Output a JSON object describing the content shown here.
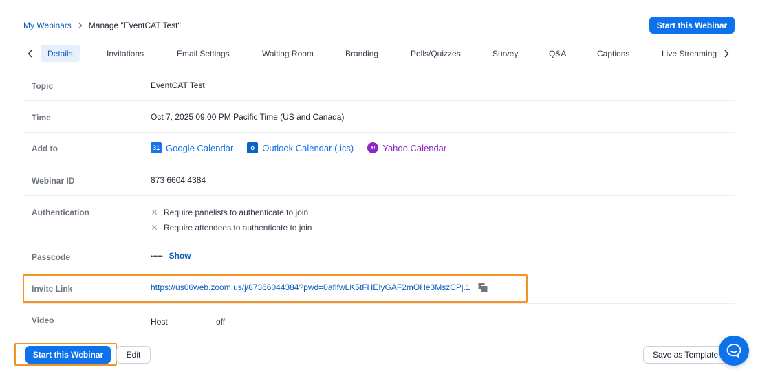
{
  "breadcrumb": {
    "root": "My Webinars",
    "current": "Manage \"EventCAT Test\""
  },
  "header": {
    "start_button": "Start this Webinar"
  },
  "tabs": [
    {
      "label": "Details",
      "active": true
    },
    {
      "label": "Invitations"
    },
    {
      "label": "Email Settings"
    },
    {
      "label": "Waiting Room"
    },
    {
      "label": "Branding"
    },
    {
      "label": "Polls/Quizzes"
    },
    {
      "label": "Survey"
    },
    {
      "label": "Q&A"
    },
    {
      "label": "Captions"
    },
    {
      "label": "Live Streaming"
    }
  ],
  "details": {
    "topic": {
      "label": "Topic",
      "value": "EventCAT Test"
    },
    "time": {
      "label": "Time",
      "value": "Oct 7, 2025 09:00 PM Pacific Time (US and Canada)"
    },
    "add_to": {
      "label": "Add to",
      "google": "Google Calendar",
      "google_icon_text": "31",
      "outlook": "Outlook Calendar (.ics)",
      "outlook_icon_text": "o",
      "yahoo": "Yahoo Calendar",
      "yahoo_icon_text": "Y!"
    },
    "webinar_id": {
      "label": "Webinar ID",
      "value": "873 6604 4384"
    },
    "authentication": {
      "label": "Authentication",
      "panelists": "Require panelists to authenticate to join",
      "attendees": "Require attendees to authenticate to join"
    },
    "passcode": {
      "label": "Passcode",
      "masked": "••••••••",
      "show": "Show"
    },
    "invite_link": {
      "label": "Invite Link",
      "url": "https://us06web.zoom.us/j/87366044384?pwd=0aflfwLK5tFHEIyGAF2mOHe3MszCPj.1"
    },
    "video": {
      "label": "Video",
      "host_label": "Host",
      "host_value": "off"
    }
  },
  "footer": {
    "start_button": "Start this Webinar",
    "edit_button": "Edit",
    "save_template_button": "Save as Template"
  },
  "colors": {
    "accent": "#0e72ed",
    "link": "#0e5dbd",
    "highlight": "#f39422",
    "yahoo": "#8d27c8"
  }
}
